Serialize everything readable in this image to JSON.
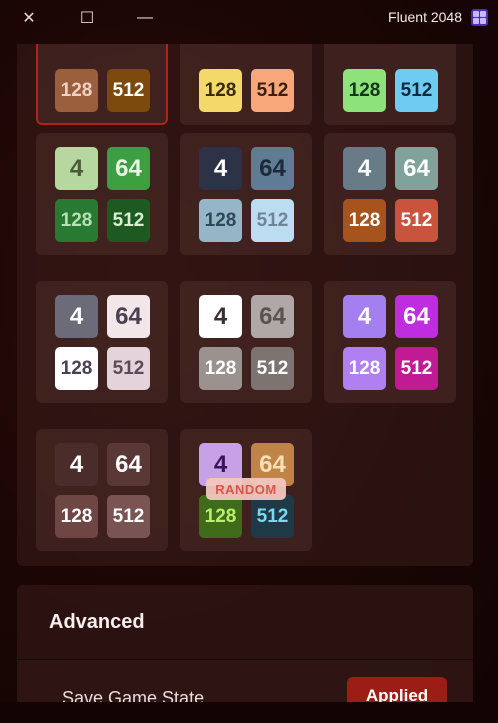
{
  "window": {
    "title": "Fluent 2048",
    "close_glyph": "✕",
    "maximize_glyph": "☐",
    "minimize_glyph": "—"
  },
  "themes": [
    {
      "name": "theme-1",
      "selected": true,
      "partial": true,
      "tiles": [
        {
          "label": "128",
          "bg": "#9a5f3c",
          "fg": "#f1d2c2"
        },
        {
          "label": "512",
          "bg": "#7b4a0c",
          "fg": "#ffffff"
        }
      ]
    },
    {
      "name": "theme-2",
      "partial": true,
      "tiles": [
        {
          "label": "128",
          "bg": "#f3d86a",
          "fg": "#3a2a10"
        },
        {
          "label": "512",
          "bg": "#f7a77a",
          "fg": "#3a1e10"
        }
      ]
    },
    {
      "name": "theme-3",
      "partial": true,
      "tiles": [
        {
          "label": "128",
          "bg": "#8ee27a",
          "fg": "#14351a"
        },
        {
          "label": "512",
          "bg": "#6fcbf2",
          "fg": "#0c2a40"
        }
      ]
    },
    {
      "name": "theme-4",
      "tiles": [
        {
          "label": "4",
          "bg": "#b7d7a0",
          "fg": "#4a5a3a"
        },
        {
          "label": "64",
          "bg": "#3d9e42",
          "fg": "#eaf6e4"
        },
        {
          "label": "128",
          "bg": "#287a33",
          "fg": "#b9dfb4"
        },
        {
          "label": "512",
          "bg": "#1d5a22",
          "fg": "#d8efd2"
        }
      ]
    },
    {
      "name": "theme-5",
      "tiles": [
        {
          "label": "4",
          "bg": "#2c3346",
          "fg": "#ffffff"
        },
        {
          "label": "64",
          "bg": "#607c94",
          "fg": "#1d2a3a"
        },
        {
          "label": "128",
          "bg": "#94b6c7",
          "fg": "#2e4858"
        },
        {
          "label": "512",
          "bg": "#bcdcf2",
          "fg": "#6f8495"
        }
      ]
    },
    {
      "name": "theme-6",
      "tiles": [
        {
          "label": "4",
          "bg": "#687c87",
          "fg": "#ffffff"
        },
        {
          "label": "64",
          "bg": "#7fa39a",
          "fg": "#ffffff"
        },
        {
          "label": "128",
          "bg": "#a6531d",
          "fg": "#ffffff"
        },
        {
          "label": "512",
          "bg": "#c9533d",
          "fg": "#ffffff"
        }
      ]
    },
    {
      "name": "theme-7",
      "tiles": [
        {
          "label": "4",
          "bg": "#6c6b7a",
          "fg": "#ffffff"
        },
        {
          "label": "64",
          "bg": "#f3e6e8",
          "fg": "#4a4050"
        },
        {
          "label": "128",
          "bg": "#ffffff",
          "fg": "#4a4050"
        },
        {
          "label": "512",
          "bg": "#e5d3dc",
          "fg": "#5a4a58"
        }
      ]
    },
    {
      "name": "theme-8",
      "tiles": [
        {
          "label": "4",
          "bg": "#ffffff",
          "fg": "#3a3030"
        },
        {
          "label": "64",
          "bg": "#b0a8a6",
          "fg": "#5a5250"
        },
        {
          "label": "128",
          "bg": "#9b918f",
          "fg": "#ffffff"
        },
        {
          "label": "512",
          "bg": "#7d7472",
          "fg": "#ffffff"
        }
      ]
    },
    {
      "name": "theme-9",
      "tiles": [
        {
          "label": "4",
          "bg": "#a47ff0",
          "fg": "#ffffff"
        },
        {
          "label": "64",
          "bg": "#c02de0",
          "fg": "#ffffff"
        },
        {
          "label": "128",
          "bg": "#b07ff2",
          "fg": "#ffffff"
        },
        {
          "label": "512",
          "bg": "#c01a95",
          "fg": "#ffffff"
        }
      ]
    },
    {
      "name": "theme-10",
      "tiles": [
        {
          "label": "4",
          "bg": "#4a2c2a",
          "fg": "#ffffff"
        },
        {
          "label": "64",
          "bg": "#5a3836",
          "fg": "#ffffff"
        },
        {
          "label": "128",
          "bg": "#6e4644",
          "fg": "#ffffff"
        },
        {
          "label": "512",
          "bg": "#7a5452",
          "fg": "#ffffff"
        }
      ]
    },
    {
      "name": "theme-random",
      "badge": "RANDOM",
      "tiles": [
        {
          "label": "4",
          "bg": "#c7a0e8",
          "fg": "#3a1458"
        },
        {
          "label": "64",
          "bg": "#c08446",
          "fg": "#f6e0b8"
        },
        {
          "label": "128",
          "bg": "#3f6b1b",
          "fg": "#b8f06a"
        },
        {
          "label": "512",
          "bg": "#1f3a46",
          "fg": "#7ad8f0"
        }
      ]
    }
  ],
  "advanced": {
    "title": "Advanced",
    "save_state_label": "Save Game State",
    "save_state_button": "Applied"
  }
}
